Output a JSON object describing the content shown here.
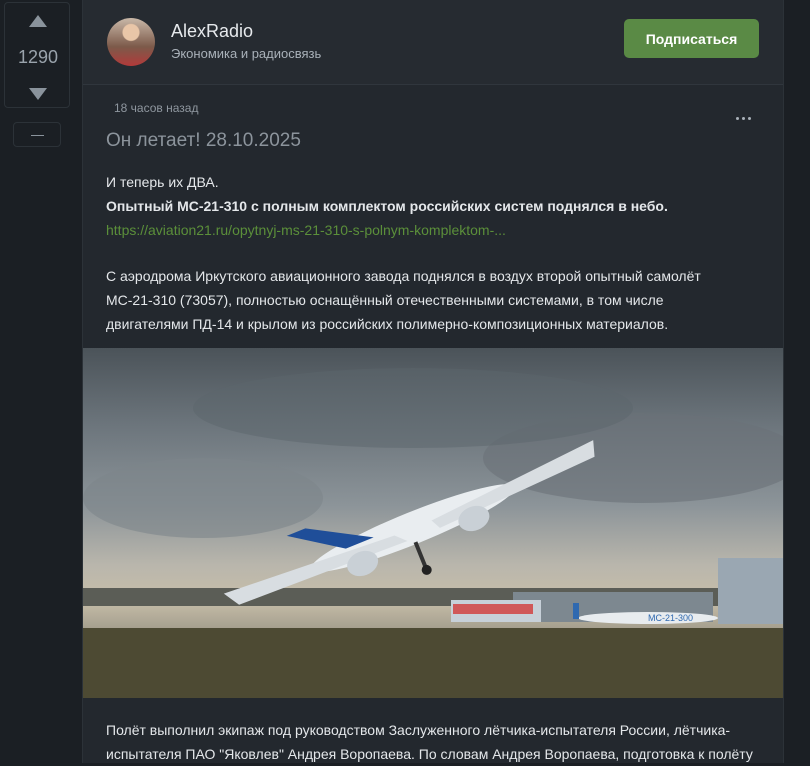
{
  "vote": {
    "count": "1290"
  },
  "author": {
    "name": "AlexRadio",
    "subtitle": "Экономика и радиосвязь"
  },
  "subscribe_label": "Подписаться",
  "post": {
    "time": "18 часов назад",
    "title": "Он летает! 28.10.2025",
    "line1": "И теперь их ДВА.",
    "line2": "Опытный МС-21-310 с полным комплектом российских систем поднялся в небо.",
    "link": "https://aviation21.ru/opytnyj-ms-21-310-s-polnym-komplektom-...",
    "para1": [
      "С аэродрома Иркутского авиационного завода поднялся в воздух второй опытный самолёт",
      "МС-21-310 (73057), полностью оснащённый отечественными системами, в том числе",
      "двигателями ПД-14 и крылом из российских полимерно-композиционных материалов."
    ],
    "para2": [
      "Полёт выполнил экипаж под руководством Заслуженного лётчика-испытателя России, лётчика-",
      "испытателя ПАО \"Яковлев\" Андрея Воропаева. По словам Андрея Воропаева, подготовка к полёту"
    ]
  },
  "photo_labels": {
    "fuselage": "МС-21-300"
  },
  "colors": {
    "subscribe": "#5a8a45",
    "link": "#5b8f3a",
    "background": "#1b1f24",
    "card": "#23282e"
  }
}
